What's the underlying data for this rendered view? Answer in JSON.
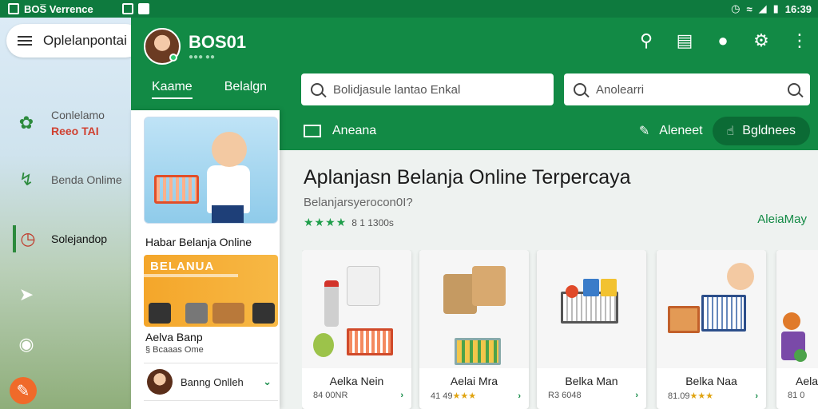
{
  "status_bar": {
    "app_name": "BOS̅ Verrence",
    "time": "16:39"
  },
  "drawer": {
    "search_text": "Oplelanpontai",
    "items": [
      {
        "line1": "Conlelamo",
        "line2": "Reeo TAI",
        "icon": "leaf-icon"
      },
      {
        "line1": "Benda Onlime",
        "line2": "",
        "icon": "chart-icon"
      },
      {
        "line1": "Solejandop",
        "line2": "",
        "icon": "clock-icon"
      },
      {
        "line1": "",
        "line2": "",
        "icon": "pin-icon"
      },
      {
        "line1": "",
        "line2": "",
        "icon": "gamepad-icon"
      }
    ],
    "fab_icon": "edit-icon"
  },
  "header": {
    "title": "BOS01",
    "subtitle": "●●● ●●",
    "tabs": [
      {
        "label": "Kaame",
        "active": true
      },
      {
        "label": "Belalgn",
        "active": false
      }
    ],
    "search1_placeholder": "Bolidjasule lantao Enkal",
    "search2_placeholder": "Anolearri",
    "sub_left": "Aneana",
    "sub_right1": "Aleneet",
    "sub_right2": "Bgldnees"
  },
  "sidebar": {
    "promo1_label": "Habar Belanja Online",
    "promo2_brand": "BELANUA",
    "promo2_title": "Aelva Banp",
    "promo2_subtitle": "§ Bcaaas Ome",
    "list_item": "Banng Onlleh"
  },
  "main": {
    "title": "Aplanjasn Belanja Online Terpercaya",
    "subtitle": "Belanjarsyerocon0I?",
    "rating_stars": "★★★★",
    "rating_text": "8 1 1300s",
    "see_all": "AleiaMay",
    "products": [
      {
        "name": "Aelka Nein",
        "price": "84 00NR",
        "stars": ""
      },
      {
        "name": "Aelai Mra",
        "price": "41 49",
        "stars": "★★★"
      },
      {
        "name": "Belka Man",
        "price": "R3 6048",
        "stars": ""
      },
      {
        "name": "Belka Naa",
        "price": "81.09",
        "stars": "★★★"
      },
      {
        "name": "Aela",
        "price": "81 0",
        "stars": ""
      }
    ]
  },
  "colors": {
    "primary": "#128a45",
    "dark": "#0b6b35",
    "accent_orange": "#f06a2a"
  }
}
